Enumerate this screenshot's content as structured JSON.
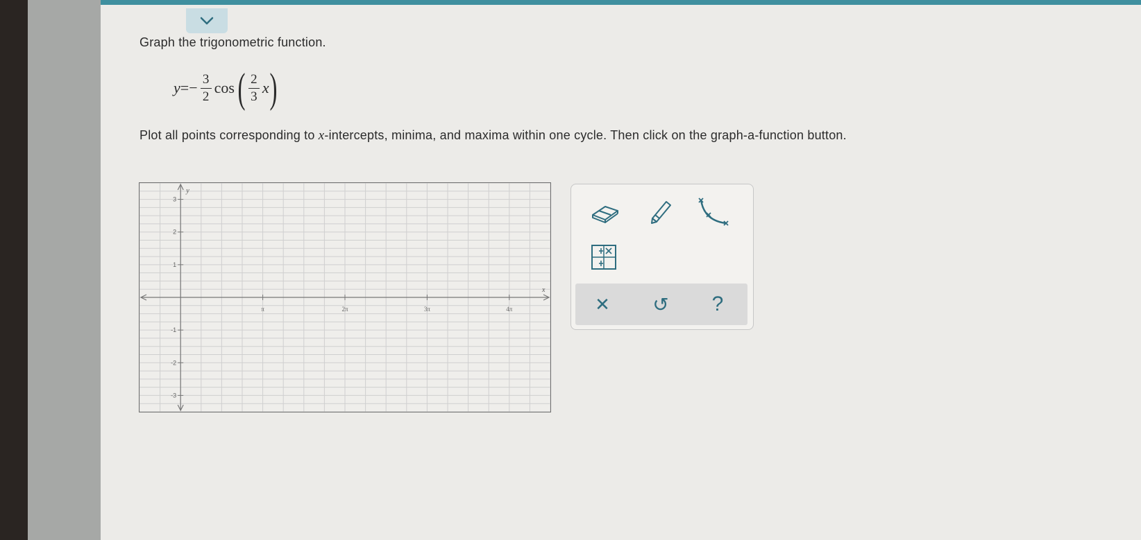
{
  "question": {
    "prompt": "Graph the trigonometric function.",
    "equation": {
      "lhs": "y",
      "equals": "=",
      "sign": "−",
      "coef_num": "3",
      "coef_den": "2",
      "func": "cos",
      "arg_num": "2",
      "arg_den": "3",
      "arg_var": "x"
    },
    "instructions_pre": "Plot all points corresponding to ",
    "instructions_var": "x",
    "instructions_post": "-intercepts, minima, and maxima within one cycle. Then click on the graph-a-function button."
  },
  "graph": {
    "x_axis_label": "x",
    "y_axis_label": "y",
    "x_ticks": [
      {
        "label": "π",
        "value": 1
      },
      {
        "label": "2π",
        "value": 2
      },
      {
        "label": "3π",
        "value": 3
      },
      {
        "label": "4π",
        "value": 4
      }
    ],
    "y_ticks": [
      {
        "label": "3",
        "value": 3
      },
      {
        "label": "2",
        "value": 2
      },
      {
        "label": "1",
        "value": 1
      },
      {
        "label": "-1",
        "value": -1
      },
      {
        "label": "-2",
        "value": -2
      },
      {
        "label": "-3",
        "value": -3
      }
    ],
    "x_range_pi": [
      -0.5,
      4.5
    ],
    "y_range": [
      -3.5,
      3.5
    ],
    "grid": true,
    "grid_x_step_pi": 0.25,
    "grid_y_step": 0.25
  },
  "tools": {
    "eraser": "eraser-icon",
    "pencil": "pencil-icon",
    "curve": "cosine-curve-icon",
    "table": "table-icon",
    "clear_symbol": "✕",
    "undo_symbol": "↺",
    "help_symbol": "?",
    "accent_color": "#2e6d7f"
  }
}
